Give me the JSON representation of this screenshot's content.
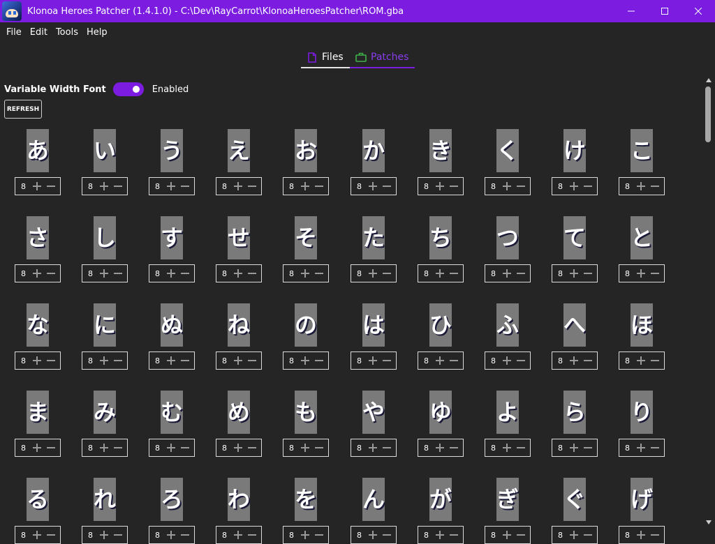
{
  "window": {
    "title": "Klonoa Heroes Patcher (1.4.1.0) - C:\\Dev\\RayCarrot\\KlonoaHeroesPatcher\\ROM.gba",
    "controls": [
      "minimize-icon",
      "maximize-icon",
      "close-icon"
    ]
  },
  "menu": [
    "File",
    "Edit",
    "Tools",
    "Help"
  ],
  "tabs": {
    "files": {
      "label": "Files",
      "icon": "file-icon",
      "selected": true
    },
    "patches": {
      "label": "Patches",
      "icon": "briefcase-icon"
    }
  },
  "vwf": {
    "label": "Variable Width Font",
    "state": "Enabled",
    "on": true
  },
  "refresh_label": "REFRESH",
  "glyphs": [
    "あ",
    "い",
    "う",
    "え",
    "お",
    "か",
    "き",
    "く",
    "け",
    "こ",
    "さ",
    "し",
    "す",
    "せ",
    "そ",
    "た",
    "ち",
    "つ",
    "て",
    "と",
    "な",
    "に",
    "ぬ",
    "ね",
    "の",
    "は",
    "ひ",
    "ふ",
    "へ",
    "ほ",
    "ま",
    "み",
    "む",
    "め",
    "も",
    "や",
    "ゆ",
    "よ",
    "ら",
    "り",
    "る",
    "れ",
    "ろ",
    "わ",
    "を",
    "ん",
    "が",
    "ぎ",
    "ぐ",
    "げ"
  ],
  "glyph_width": "8",
  "colors": {
    "accent": "#7b1ce0",
    "background": "#252525",
    "glyph_bg": "#7a7a7a"
  }
}
